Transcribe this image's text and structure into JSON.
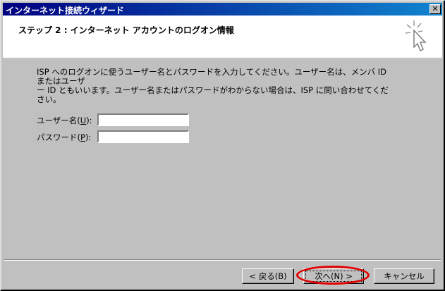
{
  "window": {
    "title": "インターネット接続ウィザード",
    "close_glyph": "✕"
  },
  "header": {
    "step_title": "ステップ 2 : インターネット アカウントのログオン情報",
    "icon": "wizard-cursor-icon"
  },
  "body": {
    "description_line1": "ISP へのログオンに使うユーザー名とパスワードを入力してください。ユーザー名は、メンバ ID またはユーザ",
    "description_line2": "ー ID ともいいます。ユーザー名またはパスワードがわからない場合は、ISP に問い合わせてください。",
    "username": {
      "label_prefix": "ユーザー名(",
      "accesskey": "U",
      "label_suffix": "):",
      "value": ""
    },
    "password": {
      "label_prefix": "パスワード(",
      "accesskey": "P",
      "label_suffix": "):",
      "value": ""
    }
  },
  "buttons": {
    "back_label": "< 戻る(B)",
    "next_label": "次へ(N) >",
    "cancel_label": "キャンセル"
  },
  "colors": {
    "titlebar": "#000080",
    "face": "#c0c0c0",
    "highlight": "#e00000"
  }
}
